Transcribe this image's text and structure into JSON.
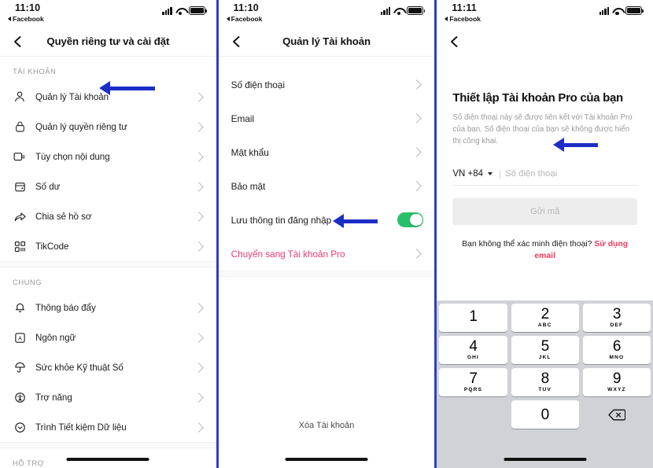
{
  "colors": {
    "arrow_blue": "#1c2dc6",
    "divider_blue": "#2b3ecb",
    "pink_link": "#ee3a72",
    "red_link": "#ee3a5c",
    "toggle_green": "#27c06a",
    "keypad_bg": "#d0d2d7"
  },
  "panel1": {
    "status": {
      "time": "11:10",
      "back_app": "Facebook"
    },
    "nav": {
      "back_icon": "chevron-left-icon",
      "title": "Quyền riêng tư và cài đặt"
    },
    "sections": [
      {
        "header": "TÀI KHOẢN",
        "items": [
          {
            "icon": "person-icon",
            "label": "Quản lý Tài khoản",
            "chevron": true,
            "annotated": true
          },
          {
            "icon": "lock-icon",
            "label": "Quản lý quyền riêng tư",
            "chevron": true
          },
          {
            "icon": "video-preferences-icon",
            "label": "Tùy chọn nội dung",
            "chevron": true
          },
          {
            "icon": "wallet-icon",
            "label": "Số dư",
            "chevron": true
          },
          {
            "icon": "share-icon",
            "label": "Chia sẻ hồ sơ",
            "chevron": true
          },
          {
            "icon": "qr-code-icon",
            "label": "TikCode",
            "chevron": true
          }
        ]
      },
      {
        "header": "CHUNG",
        "items": [
          {
            "icon": "bell-icon",
            "label": "Thông báo đẩy",
            "chevron": true
          },
          {
            "icon": "language-icon",
            "label": "Ngôn ngữ",
            "chevron": true
          },
          {
            "icon": "umbrella-icon",
            "label": "Sức khỏe Kỹ thuật Số",
            "chevron": true
          },
          {
            "icon": "accessibility-icon",
            "label": "Trợ năng",
            "chevron": true
          },
          {
            "icon": "data-saver-icon",
            "label": "Trình Tiết kiệm Dữ liệu",
            "chevron": true
          }
        ]
      },
      {
        "header": "HỖ TRỢ",
        "items": []
      }
    ]
  },
  "panel2": {
    "status": {
      "time": "11:10",
      "back_app": "Facebook"
    },
    "nav": {
      "back_icon": "chevron-left-icon",
      "title": "Quản lý Tài khoản"
    },
    "items": [
      {
        "label": "Số điện thoại",
        "type": "chevron"
      },
      {
        "label": "Email",
        "type": "chevron"
      },
      {
        "label": "Mật khẩu",
        "type": "chevron"
      },
      {
        "label": "Bảo mật",
        "type": "chevron"
      },
      {
        "label": "Lưu thông tin đăng nhập",
        "type": "toggle",
        "toggle_on": true
      },
      {
        "label": "Chuyển sang Tài khoản Pro",
        "type": "chevron",
        "pink": true,
        "annotated": true
      }
    ],
    "delete_account": "Xóa Tài khoản"
  },
  "panel3": {
    "status": {
      "time": "11:11",
      "back_app": "Facebook"
    },
    "nav": {
      "back_icon": "chevron-left-icon",
      "title": ""
    },
    "title": "Thiết lập Tài khoản Pro của bạn",
    "subtitle": "Số điện thoại này sẽ được liên kết với Tài khoản Pro của bạn. Số điện thoại của bạn sẽ không được hiển thị công khai.",
    "phone": {
      "country_code": "VN +84",
      "caret_icon": "chevron-down-icon",
      "divider": "|",
      "placeholder": "Số điện thoại",
      "value": "",
      "annotated": true
    },
    "send_code_button": "Gửi mã",
    "verify": {
      "question": "Bạn không thể xác minh điện thoại?",
      "link": "Sử dụng email"
    },
    "keypad": {
      "delete_icon": "backspace-icon",
      "keys": [
        [
          {
            "num": "1",
            "sub": ""
          },
          {
            "num": "2",
            "sub": "ABC"
          },
          {
            "num": "3",
            "sub": "DEF"
          }
        ],
        [
          {
            "num": "4",
            "sub": "GHI"
          },
          {
            "num": "5",
            "sub": "JKL"
          },
          {
            "num": "6",
            "sub": "MNO"
          }
        ],
        [
          {
            "num": "7",
            "sub": "PQRS"
          },
          {
            "num": "8",
            "sub": "TUV"
          },
          {
            "num": "9",
            "sub": "WXYZ"
          }
        ],
        [
          {
            "num": "",
            "sub": "",
            "blank": true
          },
          {
            "num": "0",
            "sub": ""
          },
          {
            "num": "",
            "sub": "",
            "del": true
          }
        ]
      ]
    }
  }
}
